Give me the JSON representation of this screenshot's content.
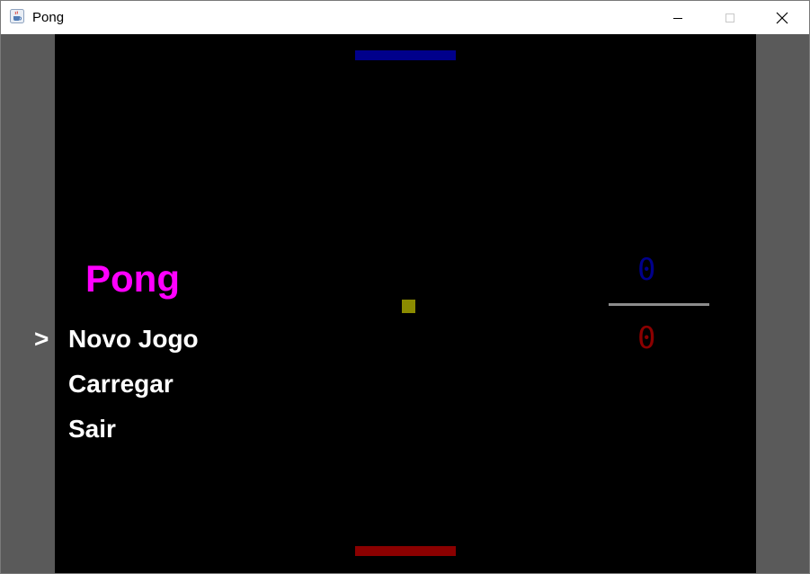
{
  "window": {
    "title": "Pong"
  },
  "icons": {
    "app": "java-cup-icon",
    "minimize": "minimize-icon",
    "maximize": "maximize-icon",
    "close": "close-icon"
  },
  "game": {
    "title": "Pong",
    "menu": {
      "cursor": ">",
      "selected_index": 0,
      "items": [
        "Novo Jogo",
        "Carregar",
        "Sair"
      ]
    },
    "score": {
      "top": "0",
      "bottom": "0"
    }
  },
  "colors": {
    "background": "#000000",
    "side_margin": "#5a5a5a",
    "title": "#ff00ff",
    "menu_text": "#ffffff",
    "top_paddle": "#00008b",
    "bottom_paddle": "#8b0000",
    "ball": "#8b8b00",
    "top_score": "#00008b",
    "bottom_score": "#8b0000",
    "score_divider": "#8c8c8c"
  }
}
